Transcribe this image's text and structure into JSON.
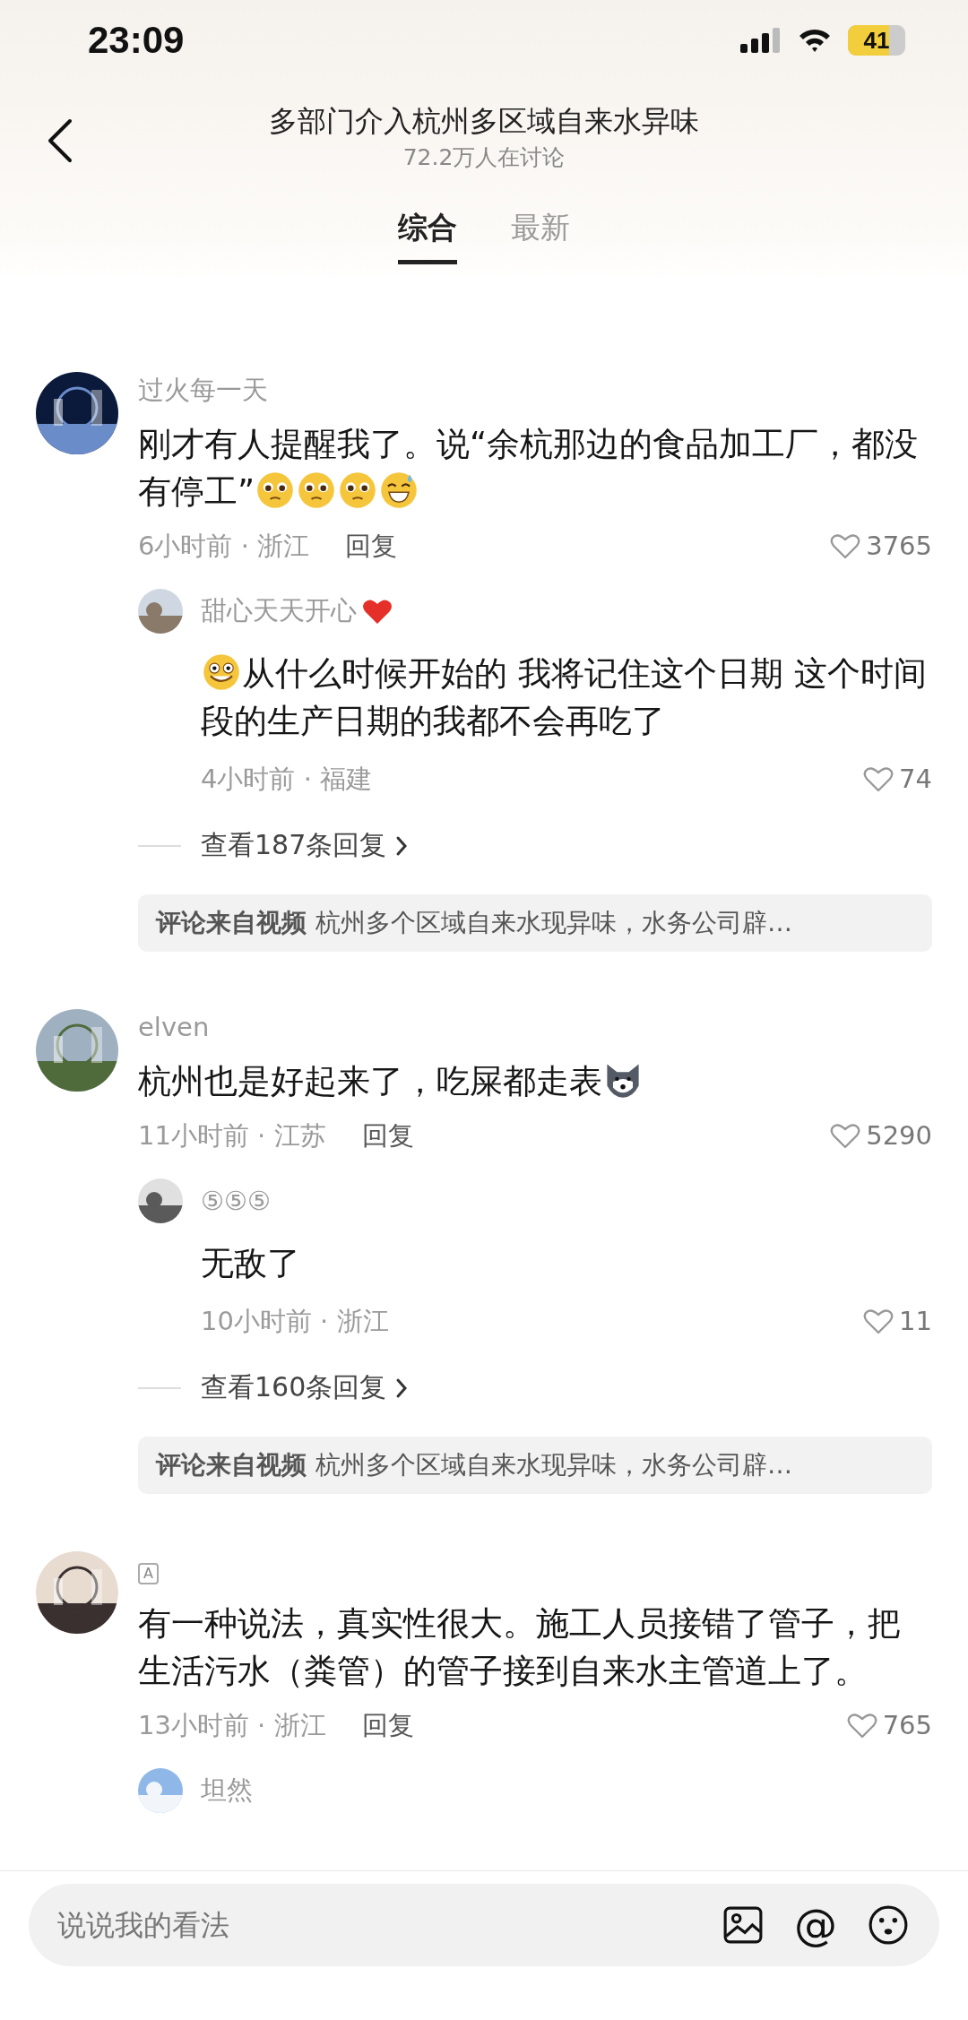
{
  "status_bar": {
    "time": "23:09",
    "battery": "41"
  },
  "header": {
    "title": "多部门介入杭州多区域自来水异味",
    "subtitle": "72.2万人在讨论"
  },
  "tabs": [
    {
      "label": "综合",
      "selected": true
    },
    {
      "label": "最新",
      "selected": false
    }
  ],
  "comments": [
    {
      "user": "过火每一天",
      "text": "刚才有人提醒我了。说“余杭那边的食品加工厂，都没有停工”",
      "emojis_after": [
        {
          "kind": "pleading"
        },
        {
          "kind": "pleading"
        },
        {
          "kind": "pleading"
        },
        {
          "kind": "grin-sweat"
        }
      ],
      "time_location": "6小时前 · 浙江",
      "reply_label": "回复",
      "likes": "3765",
      "replies": [
        {
          "user": "甜心天天开心",
          "name_heart": true,
          "emojis_before": [
            {
              "kind": "grin"
            }
          ],
          "text": "从什么时候开始的 我将记住这个日期 这个时间段的生产日期的我都不会再吃了",
          "time_location": "4小时前 · 福建",
          "likes": "74"
        }
      ],
      "more_replies": "查看187条回复",
      "source": {
        "label": "评论来自视频",
        "text": "杭州多个区域自来水现异味，水务公司辟…"
      }
    },
    {
      "user": "elven",
      "text": "杭州也是好起来了，吃屎都走表",
      "emojis_after": [
        {
          "kind": "wolf"
        }
      ],
      "time_location": "11小时前 · 江苏",
      "reply_label": "回复",
      "likes": "5290",
      "replies": [
        {
          "user": "⑤⑤⑤",
          "name_heart": false,
          "text": "无敌了",
          "time_location": "10小时前 · 浙江",
          "likes": "11"
        }
      ],
      "more_replies": "查看160条回复",
      "source": {
        "label": "评论来自视频",
        "text": "杭州多个区域自来水现异味，水务公司辟…"
      }
    },
    {
      "user_badge": "A",
      "text": "有一种说法，真实性很大。施工人员接错了管子，把生活污水（粪管）的管子接到自来水主管道上了。",
      "time_location": "13小时前 · 浙江",
      "reply_label": "回复",
      "likes": "765",
      "replies": [
        {
          "user": "坦然",
          "name_heart": false
        }
      ]
    }
  ],
  "input": {
    "placeholder": "说说我的看法",
    "mention": "@"
  }
}
